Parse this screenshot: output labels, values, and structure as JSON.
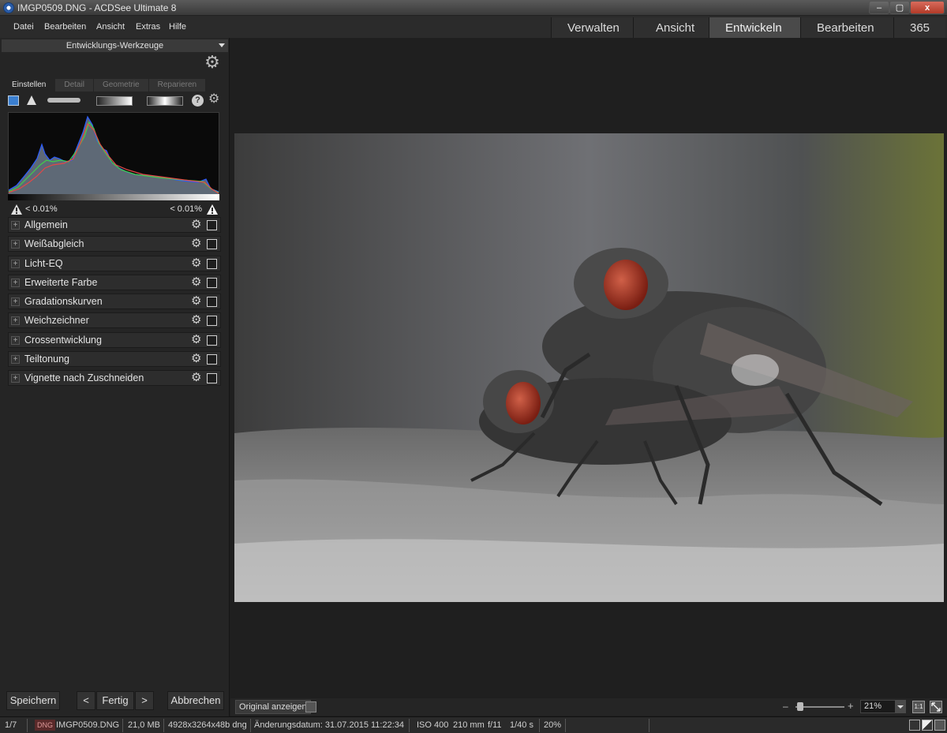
{
  "window": {
    "title": "IMGP0509.DNG - ACDSee Ultimate 8",
    "controls": {
      "minimize": "–",
      "maximize": "▢",
      "close": "x"
    }
  },
  "menu": [
    "Datei",
    "Bearbeiten",
    "Ansicht",
    "Extras",
    "Hilfe"
  ],
  "modes": [
    {
      "label": "Verwalten",
      "active": false
    },
    {
      "label": "Ansicht",
      "active": false
    },
    {
      "label": "Entwickeln",
      "active": true
    },
    {
      "label": "Bearbeiten",
      "active": false
    },
    {
      "label": "365",
      "active": false
    }
  ],
  "panel": {
    "header": "Entwicklungs-Werkzeuge",
    "subtabs": [
      "Einstellen",
      "Detail",
      "Geometrie",
      "Reparieren"
    ],
    "tools_help": "?",
    "clipping": {
      "shadows": "< 0.01%",
      "highlights": "< 0.01%"
    },
    "groups": [
      "Allgemein",
      "Weißabgleich",
      "Licht-EQ",
      "Erweiterte Farbe",
      "Gradationskurven",
      "Weichzeichner",
      "Crossentwicklung",
      "Teiltonung",
      "Vignette nach Zuschneiden"
    ],
    "buttons": {
      "save": "Speichern",
      "prev": "<",
      "done": "Fertig",
      "next": ">",
      "cancel": "Abbrechen"
    }
  },
  "viewer": {
    "show_original": "Original anzeigen",
    "zoom_minus": "–",
    "zoom_plus": "+",
    "zoom": "21%",
    "zoom_1to1": "1:1"
  },
  "status": {
    "index": "1/7",
    "type_badge": "DNG",
    "filename": "IMGP0509.DNG",
    "size": "21,0 MB",
    "dimensions": "4928x3264x48b dng",
    "modified": "Änderungsdatum: 31.07.2015 11:22:34",
    "iso": "ISO 400",
    "focal": "210 mm",
    "aperture": "f/11",
    "shutter": "1/40 s",
    "zoom": "20%"
  },
  "colors": {
    "accent_active": "#4a4a4a",
    "panel_bg": "#252525",
    "close_button": "#b23a28"
  }
}
